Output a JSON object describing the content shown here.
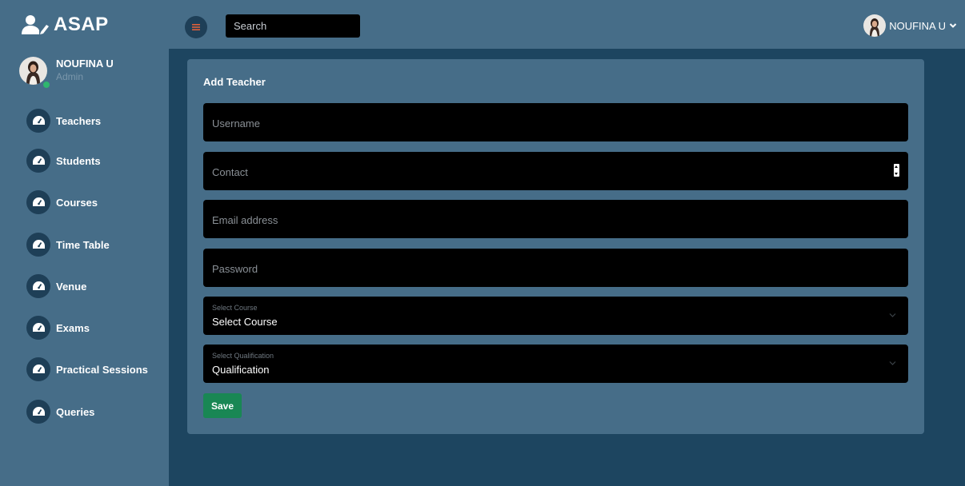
{
  "app": {
    "brand": "ASAP"
  },
  "header": {
    "search_placeholder": "Search",
    "user_name": "NOUFINA U"
  },
  "sidebar": {
    "profile": {
      "name": "NOUFINA U",
      "role": "Admin"
    },
    "items": [
      {
        "label": "Teachers"
      },
      {
        "label": "Students"
      },
      {
        "label": "Courses"
      },
      {
        "label": "Time Table"
      },
      {
        "label": "Venue"
      },
      {
        "label": "Exams"
      },
      {
        "label": "Practical Sessions"
      },
      {
        "label": "Queries"
      }
    ]
  },
  "form": {
    "title": "Add Teacher",
    "username_placeholder": "Username",
    "contact_placeholder": "Contact",
    "email_placeholder": "Email address",
    "password_placeholder": "Password",
    "course_select": {
      "label": "Select Course",
      "value": "Select Course"
    },
    "qualification_select": {
      "label": "Select Qualification",
      "value": "Qualification"
    },
    "save_label": "Save"
  },
  "colors": {
    "background": "#1d4560",
    "panel": "#466d88",
    "field": "#000000",
    "save_button": "#198754",
    "online": "#2fb66e"
  }
}
